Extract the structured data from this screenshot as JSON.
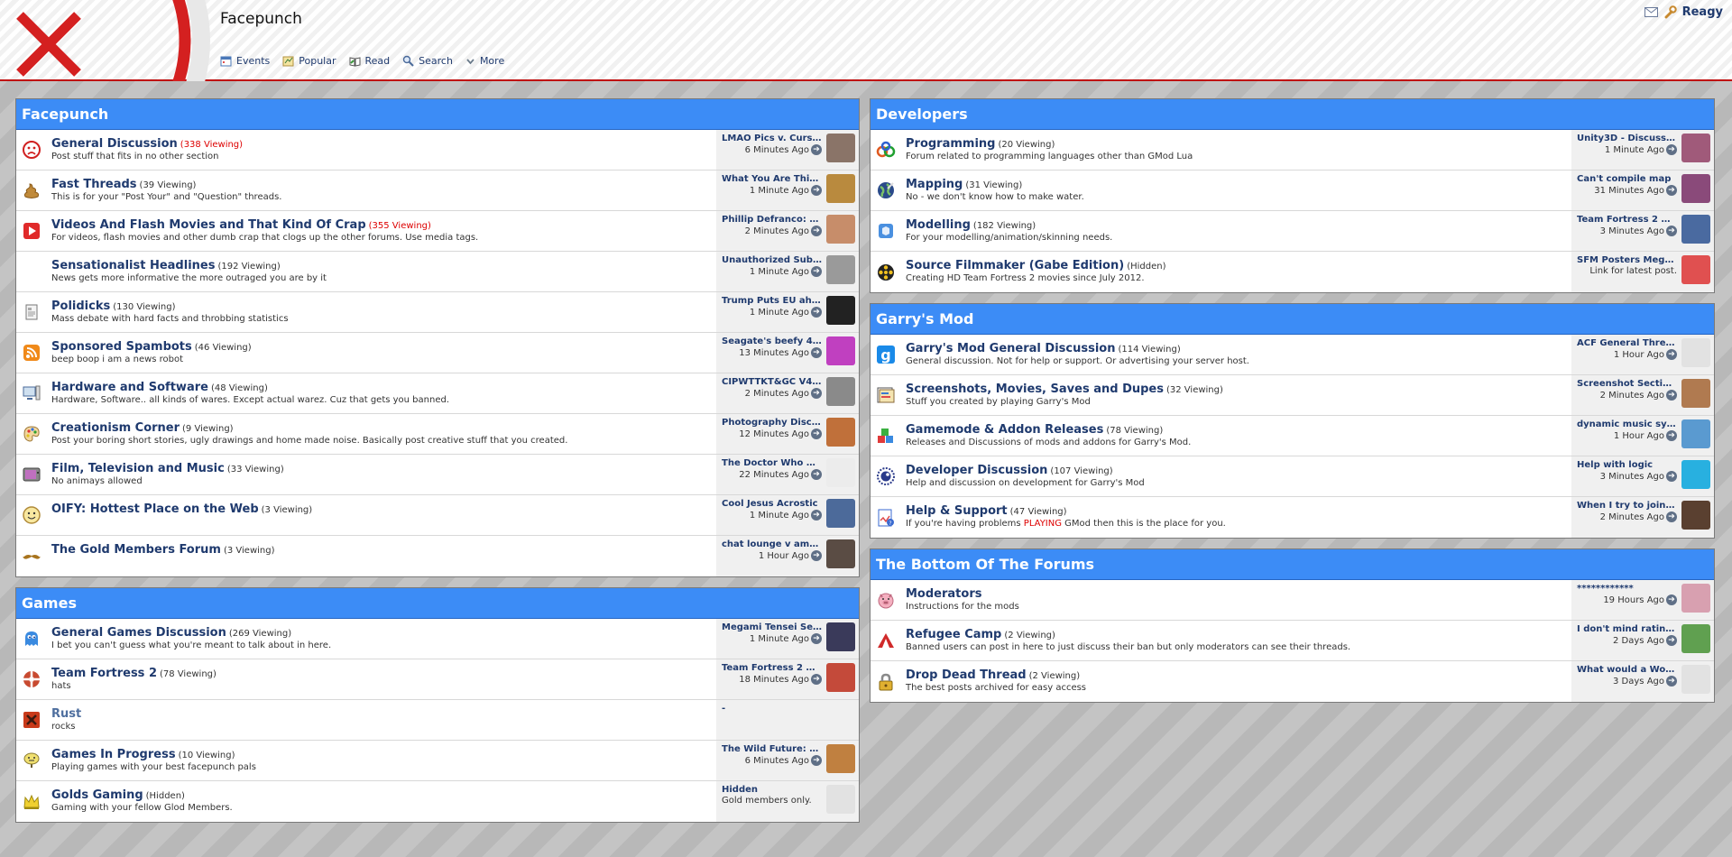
{
  "header": {
    "site_title": "Facepunch",
    "nav": [
      {
        "label": "Events",
        "icon": "events-icon"
      },
      {
        "label": "Popular",
        "icon": "popular-icon"
      },
      {
        "label": "Read",
        "icon": "read-icon"
      },
      {
        "label": "Search",
        "icon": "search-icon"
      },
      {
        "label": "More",
        "icon": "more-icon"
      }
    ],
    "user": {
      "name": "Reagy",
      "icons": [
        "mail-icon",
        "wrench-icon"
      ]
    }
  },
  "colors": {
    "section_header": "#3c8cf6",
    "link": "#1f3a6e",
    "hot_viewing": "#dd0000",
    "header_border": "#c01010"
  },
  "left_sections": [
    {
      "title": "Facepunch",
      "forums": [
        {
          "title": "General Discussion",
          "viewing": "(338 Viewing)",
          "hot": true,
          "desc": "Post stuff that fits in no other section",
          "icon": "sad-face-icon",
          "last_title": "LMAO Pics v. Cursed",
          "last_time": "6 Minutes Ago",
          "avatar": "#8a7468"
        },
        {
          "title": "Fast Threads",
          "viewing": "(39 Viewing)",
          "hot": false,
          "desc": "This is for your \"Post Your\" and \"Question\" threads.",
          "icon": "poop-icon",
          "last_title": "What You Are Thinki...",
          "last_time": "1 Minute Ago",
          "avatar": "#b98a3e"
        },
        {
          "title": "Videos And Flash Movies and That Kind Of Crap",
          "viewing": "(355 Viewing)",
          "hot": true,
          "desc": "For videos, flash movies and other dumb crap that clogs up the other forums. Use media tags.",
          "icon": "video-play-icon",
          "last_title": "Phillip Defranco: Wo...",
          "last_time": "2 Minutes Ago",
          "avatar": "#c78d6a"
        },
        {
          "title": "Sensationalist Headlines",
          "viewing": "(192 Viewing)",
          "hot": false,
          "desc": "News gets more informative the more outraged you are by it",
          "icon": "blank-icon",
          "last_title": "Unauthorized Subtitl...",
          "last_time": "1 Minute Ago",
          "avatar": "#9a9a9a"
        },
        {
          "title": "Polidicks",
          "viewing": "(130 Viewing)",
          "hot": false,
          "desc": "Mass debate with hard facts and throbbing statistics",
          "icon": "document-icon",
          "last_title": "Trump Puts EU ahea...",
          "last_time": "1 Minute Ago",
          "avatar": "#222222"
        },
        {
          "title": "Sponsored Spambots",
          "viewing": "(46 Viewing)",
          "hot": false,
          "desc": "beep boop i am a news robot",
          "icon": "rss-icon",
          "last_title": "Seagate's beefy 4TB ...",
          "last_time": "13 Minutes Ago",
          "avatar": "#c040c0"
        },
        {
          "title": "Hardware and Software",
          "viewing": "(48 Viewing)",
          "hot": false,
          "desc": "Hardware, Software.. all kinds of wares. Except actual warez. Cuz that gets you banned.",
          "icon": "computer-icon",
          "last_title": "CIPWTTKT&GC V43 ...",
          "last_time": "2 Minutes Ago",
          "avatar": "#8a8a8a"
        },
        {
          "title": "Creationism Corner",
          "viewing": "(9 Viewing)",
          "hot": false,
          "desc": "Post your boring short stories, ugly drawings and home made noise. Basically post creative stuff that you created.",
          "icon": "palette-icon",
          "last_title": "Photography Discus...",
          "last_time": "12 Minutes Ago",
          "avatar": "#c0703a"
        },
        {
          "title": "Film, Television and Music",
          "viewing": "(33 Viewing)",
          "hot": false,
          "desc": "No animays allowed",
          "icon": "tv-icon",
          "last_title": "The Doctor Who Spo...",
          "last_time": "22 Minutes Ago",
          "avatar": "#ececec"
        },
        {
          "title": "OIFY: Hottest Place on the Web",
          "viewing": "(3 Viewing)",
          "hot": false,
          "desc": "",
          "icon": "smiley-icon",
          "last_title": "Cool Jesus Acrostic",
          "last_time": "1 Minute Ago",
          "avatar": "#4c6a9a"
        },
        {
          "title": "The Gold Members Forum",
          "viewing": "(3 Viewing)",
          "hot": false,
          "desc": "",
          "icon": "mustache-icon",
          "last_title": "chat lounge v amate...",
          "last_time": "1 Hour Ago",
          "avatar": "#5a4c44"
        }
      ]
    },
    {
      "title": "Games",
      "forums": [
        {
          "title": "General Games Discussion",
          "viewing": "(269 Viewing)",
          "hot": false,
          "desc": "I bet you can't guess what you're meant to talk about in here.",
          "icon": "ghost-icon",
          "last_title": "Megami Tensei Serie...",
          "last_time": "1 Minute Ago",
          "avatar": "#3a3a5a"
        },
        {
          "title": "Team Fortress 2",
          "viewing": "(78 Viewing)",
          "hot": false,
          "desc": "hats",
          "icon": "tf2-icon",
          "last_title": "Team Fortress 2 Gen...",
          "last_time": "18 Minutes Ago",
          "avatar": "#c44a3a"
        },
        {
          "title": "Rust",
          "viewing": "",
          "hot": false,
          "dim": true,
          "desc": "rocks",
          "icon": "rust-icon",
          "last_title": "-",
          "last_time": "",
          "avatar": ""
        },
        {
          "title": "Games In Progress",
          "viewing": "(10 Viewing)",
          "hot": false,
          "desc": "Playing games with your best facepunch pals",
          "icon": "sign-icon",
          "last_title": "The Wild Future: A S...",
          "last_time": "6 Minutes Ago",
          "avatar": "#c08040"
        },
        {
          "title": "Golds Gaming",
          "viewing": "(Hidden)",
          "hot": false,
          "desc": "Gaming with your fellow Glod Members.",
          "icon": "crown-icon",
          "last_title": "Hidden",
          "last_time": "Gold members only.",
          "avatar": "#e2e2e2",
          "last_time_left": true
        }
      ]
    }
  ],
  "right_sections": [
    {
      "title": "Developers",
      "forums": [
        {
          "title": "Programming",
          "viewing": "(20 Viewing)",
          "hot": false,
          "desc": "Forum related to programming languages other than GMod Lua",
          "icon": "gears-icon",
          "last_title": "Unity3D - Discussion",
          "last_time": "1 Minute Ago",
          "avatar": "#a05a7a"
        },
        {
          "title": "Mapping",
          "viewing": "(31 Viewing)",
          "hot": false,
          "desc": "No - we don't know how to make water.",
          "icon": "globe-icon",
          "last_title": "Can't compile map",
          "last_time": "31 Minutes Ago",
          "avatar": "#8a4a7a"
        },
        {
          "title": "Modelling",
          "viewing": "(182 Viewing)",
          "hot": false,
          "desc": "For your modelling/animation/skinning needs.",
          "icon": "cube-icon",
          "last_title": "Team Fortress 2 We...",
          "last_time": "3 Minutes Ago",
          "avatar": "#4a6aa0"
        },
        {
          "title": "Source Filmmaker (Gabe Edition)",
          "viewing": "(Hidden)",
          "hot": false,
          "desc": "Creating HD Team Fortress 2 movies since July 2012.",
          "icon": "film-reel-icon",
          "last_title": "SFM Posters Megath...",
          "last_time": "Link for latest post.",
          "avatar": "#e05050"
        }
      ]
    },
    {
      "title": "Garry's Mod",
      "forums": [
        {
          "title": "Garry's Mod General Discussion",
          "viewing": "(114 Viewing)",
          "hot": false,
          "desc": "General discussion. Not for help or support. Or advertising your server host.",
          "icon": "gmod-icon",
          "last_title": "ACF General Thread ...",
          "last_time": "1 Hour Ago",
          "avatar": "#e2e2e2"
        },
        {
          "title": "Screenshots, Movies, Saves and Dupes",
          "viewing": "(32 Viewing)",
          "hot": false,
          "desc": "Stuff you created by playing Garry's Mod",
          "icon": "screenshot-icon",
          "last_title": "Screenshot Section ...",
          "last_time": "2 Minutes Ago",
          "avatar": "#b07a50"
        },
        {
          "title": "Gamemode & Addon Releases",
          "viewing": "(78 Viewing)",
          "hot": false,
          "desc": "Releases and Discussions of mods and addons for Garry's Mod.",
          "icon": "blocks-icon",
          "last_title": "dynamic music syste...",
          "last_time": "1 Hour Ago",
          "avatar": "#5a9ad0"
        },
        {
          "title": "Developer Discussion",
          "viewing": "(107 Viewing)",
          "hot": false,
          "desc": "Help and discussion on development for Garry's Mod",
          "icon": "lua-icon",
          "last_title": "Help with logic",
          "last_time": "3 Minutes Ago",
          "avatar": "#28b0e0"
        },
        {
          "title": "Help & Support",
          "viewing": "(47 Viewing)",
          "hot": false,
          "desc_parts": [
            "If you're having problems ",
            "PLAYING",
            " GMod then this is the place for you."
          ],
          "icon": "help-icon",
          "last_title": "When I try to join th...",
          "last_time": "2 Minutes Ago",
          "avatar": "#5a4030"
        }
      ]
    },
    {
      "title": "The Bottom Of The Forums",
      "forums": [
        {
          "title": "Moderators",
          "viewing": "",
          "hot": false,
          "desc": "Instructions for the mods",
          "icon": "pig-icon",
          "last_title": "************",
          "last_time": "19 Hours Ago",
          "avatar": "#d8a0b0",
          "plain_title": true
        },
        {
          "title": "Refugee Camp",
          "viewing": "(2 Viewing)",
          "hot": false,
          "desc": "Banned users can post in here to just discuss their ban but only moderators can see their threads.",
          "icon": "tent-icon",
          "last_title": "I don't mind ratings",
          "last_time": "2 Days Ago",
          "avatar": "#60a050"
        },
        {
          "title": "Drop Dead Thread",
          "viewing": "(2 Viewing)",
          "hot": false,
          "desc": "The best posts archived for easy access",
          "icon": "lock-icon",
          "last_title": "What would a World...",
          "last_time": "3 Days Ago",
          "avatar": "#e2e2e2"
        }
      ]
    }
  ]
}
